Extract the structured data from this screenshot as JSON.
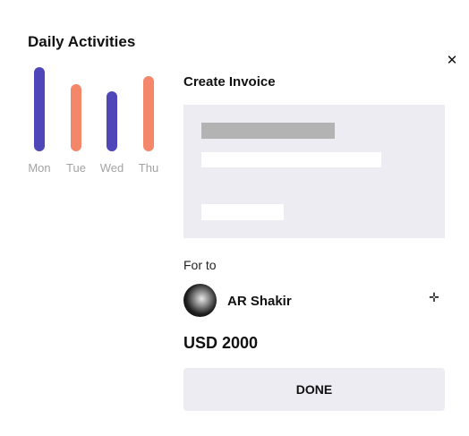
{
  "activity_card": {
    "title": "Daily Activities"
  },
  "chart_data": {
    "type": "bar",
    "categories": [
      "Mon",
      "Tue",
      "Wed",
      "Thu"
    ],
    "values": [
      0.82,
      0.65,
      0.58,
      0.73
    ],
    "colors": [
      "#4f46ba",
      "#f4876a",
      "#4f46ba",
      "#f4876a"
    ],
    "ylim": [
      0,
      1
    ],
    "grid": false,
    "title": "Daily Activities"
  },
  "invoice": {
    "close_icon": "close-icon",
    "title": "Create Invoice",
    "for_label": "For to",
    "recipient_name": "AR Shakir",
    "add_icon": "plus-icon",
    "amount": "USD 2000",
    "done_label": "DONE"
  },
  "colors": {
    "primary_bar": "#4f46ba",
    "accent_bar": "#f4876a",
    "panel_bg": "#edecf2",
    "placeholder_gray": "#b3b3b3"
  }
}
